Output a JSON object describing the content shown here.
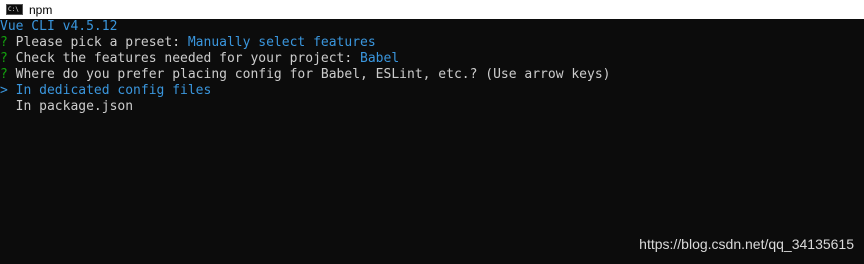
{
  "window": {
    "title": "npm",
    "icon": "terminal-icon",
    "icon_text": "C:\\"
  },
  "terminal": {
    "header": "Vue CLI v4.5.12",
    "q1": {
      "mark": "?",
      "prompt": " Please pick a preset: ",
      "answer": "Manually select features"
    },
    "q2": {
      "mark": "?",
      "prompt": " Check the features needed for your project: ",
      "answer": "Babel"
    },
    "q3": {
      "mark": "?",
      "prompt": " Where do you prefer placing config for Babel, ESLint, etc.? (Use arrow keys)"
    },
    "options": [
      {
        "pointer": ">",
        "label": " In dedicated config files"
      },
      {
        "pointer": " ",
        "label": " In package.json"
      }
    ]
  },
  "watermark": "https://blog.csdn.net/qq_34135615",
  "colors": {
    "background": "#0c0c0c",
    "text": "#cccccc",
    "accent_blue": "#3a96dd",
    "question_green": "#13a10e"
  }
}
